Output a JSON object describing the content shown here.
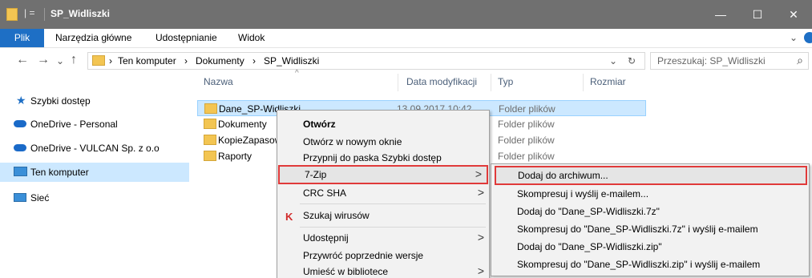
{
  "window": {
    "title": "SP_Widliszki",
    "qa_sep": "| =",
    "buttons": {
      "minimize": "—",
      "maximize": "☐",
      "close": "✕"
    }
  },
  "ribbon": {
    "tabs": [
      "Plik",
      "Narzędzia główne",
      "Udostępnianie",
      "Widok"
    ],
    "collapse": "⌄"
  },
  "address": {
    "back": "←",
    "forward": "→",
    "recent": "⌄",
    "up": "↑",
    "crumbs": [
      "Ten komputer",
      "Dokumenty",
      "SP_Widliszki"
    ],
    "sep": "›",
    "dropdown": "⌄",
    "refresh": "↻",
    "search_placeholder": "Przeszukaj: SP_Widliszki",
    "search_icon": "⌕"
  },
  "sidebar": {
    "items": [
      {
        "label": "Szybki dostęp",
        "icon": "star-icon",
        "color": "#1e6fc5"
      },
      {
        "label": "OneDrive - Personal",
        "icon": "cloud-icon",
        "color": "#1a6ac8"
      },
      {
        "label": "OneDrive - VULCAN Sp. z o.o",
        "icon": "cloud-icon",
        "color": "#1a6ac8"
      },
      {
        "label": "Ten komputer",
        "icon": "computer-icon",
        "color": "#3a8fd8"
      },
      {
        "label": "Sieć",
        "icon": "network-icon",
        "color": "#3a8fd8"
      }
    ]
  },
  "columns": {
    "name": "Nazwa",
    "date": "Data modyfikacji",
    "type": "Typ",
    "size": "Rozmiar",
    "sort_indicator": "^"
  },
  "files": [
    {
      "name": "Dane_SP-Widliszki",
      "date": "13.09.2017 10:42",
      "type": "Folder plików"
    },
    {
      "name": "Dokumenty",
      "date": "",
      "type": "Folder plików"
    },
    {
      "name": "KopieZapasowe",
      "date": "",
      "type": "Folder plików"
    },
    {
      "name": "Raporty",
      "date": "",
      "type": "Folder plików"
    }
  ],
  "context_menu": {
    "items": [
      "Otwórz",
      "Otwórz w nowym oknie",
      "Przypnij do paska Szybki dostęp",
      "7-Zip",
      "CRC SHA",
      "Szukaj wirusów",
      "Udostępnij",
      "Przywróć poprzednie wersje",
      "Umieść w bibliotece"
    ],
    "submenu_arrow": ">"
  },
  "submenu": {
    "items": [
      "Dodaj do archiwum...",
      "Skompresuj i wyślij e-mailem...",
      "Dodaj do \"Dane_SP-Widliszki.7z\"",
      "Skompresuj do \"Dane_SP-Widliszki.7z\" i wyślij e-mailem",
      "Dodaj do \"Dane_SP-Widliszki.zip\"",
      "Skompresuj do \"Dane_SP-Widliszki.zip\" i wyślij e-mailem"
    ]
  },
  "highlight_color": "#e03a3a"
}
